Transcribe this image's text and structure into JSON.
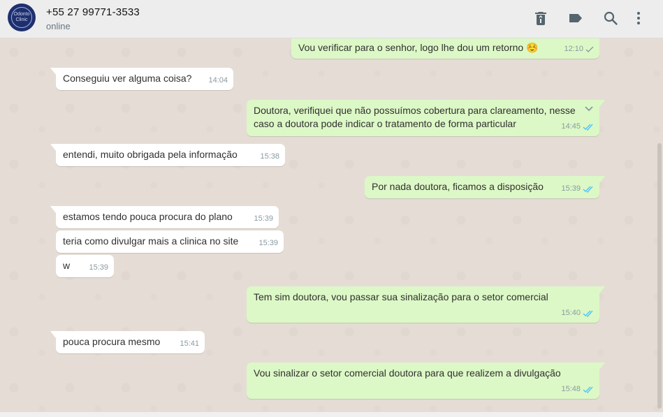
{
  "header": {
    "avatar_text": "Odonto Clinic",
    "contact_name": "+55 27 99771-3533",
    "status": "online",
    "icons": [
      "delete-icon",
      "label-icon",
      "search-icon",
      "menu-icon"
    ]
  },
  "colors": {
    "incoming_bubble": "#ffffff",
    "outgoing_bubble": "#dcf8c6",
    "read_tick": "#4fc3f7",
    "sent_tick": "#8a9aa2"
  },
  "messages": [
    {
      "dir": "out",
      "text": "Vou verificar para o senhor, logo lhe dou um retorno ☺️",
      "time": "12:10",
      "status": "sent"
    },
    {
      "dir": "in",
      "text": "Conseguiu ver alguma coisa?",
      "time": "14:04"
    },
    {
      "dir": "out",
      "text": "Doutora, verifiquei que não possuímos cobertura para clareamento, nesse caso a doutora pode indicar o tratamento de forma particular",
      "time": "14:45",
      "status": "read"
    },
    {
      "dir": "in",
      "text": "entendi, muito obrigada pela informação",
      "time": "15:38"
    },
    {
      "dir": "out",
      "text": "Por nada doutora, ficamos a disposição",
      "time": "15:39",
      "status": "read"
    },
    {
      "dir": "in",
      "text": "estamos tendo pouca procura do plano",
      "time": "15:39"
    },
    {
      "dir": "in",
      "text": "teria como divulgar mais a clinica no site",
      "time": "15:39"
    },
    {
      "dir": "in",
      "text": "w",
      "time": "15:39"
    },
    {
      "dir": "out",
      "text": "Tem sim doutora, vou passar sua sinalização para o setor comercial",
      "time": "15:40",
      "status": "read"
    },
    {
      "dir": "in",
      "text": "pouca procura mesmo",
      "time": "15:41"
    },
    {
      "dir": "out",
      "text": "Vou sinalizar o setor comercial doutora para que realizem a divulgação",
      "time": "15:48",
      "status": "read"
    }
  ]
}
